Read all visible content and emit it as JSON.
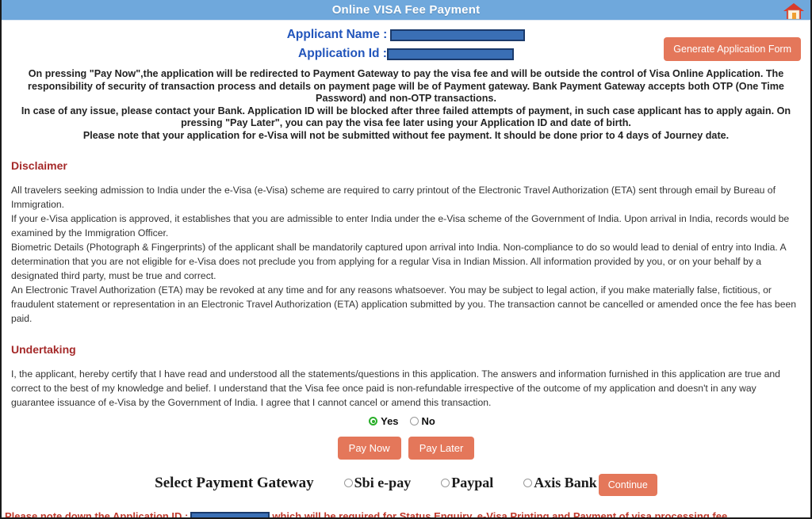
{
  "window": {
    "title": "Online VISA Fee Payment",
    "home_icon": "home-icon",
    "titlebar_color": "#6fa8dc"
  },
  "applicant": {
    "name_label": "Applicant Name :",
    "name_value": "",
    "appid_label": "Application Id :",
    "appid_value": "",
    "generate_button": "Generate Application Form",
    "label_color": "#2255bb",
    "redaction_color": "#3a6fb5"
  },
  "instructions": {
    "line1": "On pressing \"Pay Now\",the application will be redirected to Payment Gateway to pay the visa fee and will be outside the control of Visa Online Application. The responsibility of security of transaction process and details on payment page will be of Payment gateway. Bank Payment Gateway accepts both OTP (One Time Password) and non-OTP transactions.",
    "line2": "In case of any issue, please contact your Bank. Application ID will be blocked after three failed attempts of payment, in such case applicant has to apply again. On pressing \"Pay Later\", you can pay the visa fee later using your Application ID and date of birth.",
    "line3": "Please note that your application for e-Visa will not be submitted without fee payment. It should be done prior to 4 days of Journey date."
  },
  "disclaimer": {
    "heading": "Disclaimer",
    "heading_color": "#a52a2a",
    "para1": "All travelers seeking admission to India under the e-Visa (e-Visa) scheme are required to carry printout of the Electronic Travel Authorization (ETA) sent through email by Bureau of Immigration.",
    "para2": "If your e-Visa application is approved, it establishes that you are admissible to enter India under the e-Visa scheme of the Government of India. Upon arrival in India, records would be examined by the Immigration Officer.",
    "para3": "Biometric Details (Photograph & Fingerprints) of the applicant shall be mandatorily captured upon arrival into India. Non-compliance to do so would lead to denial of entry into India. A determination that you are not eligible for e-Visa does not preclude you from applying for a regular Visa in Indian Mission. All information provided by you, or on your behalf by a designated third party, must be true and correct.",
    "para4": "An Electronic Travel Authorization (ETA) may be revoked at any time and for any reasons whatsoever. You may be subject to legal action, if you make materially false, fictitious, or fraudulent statement or representation in an Electronic Travel Authorization (ETA) application submitted by you. The transaction cannot be cancelled or amended once the fee has been paid."
  },
  "undertaking": {
    "heading": "Undertaking",
    "heading_color": "#a52a2a",
    "para1": "I, the applicant, hereby certify that I have read and understood all the statements/questions in this application. The answers and information furnished in this application are true and correct to the best of my knowledge and belief. I understand that the Visa fee once paid is non-refundable irrespective of the outcome of my application and doesn't in any way guarantee issuance of e-Visa by the Government of India. I agree that I cannot cancel or amend this transaction.",
    "yes_label": "Yes",
    "no_label": "No",
    "selected": "Yes",
    "selected_color": "#2aaf2a"
  },
  "actions": {
    "pay_now": "Pay Now",
    "pay_later": "Pay Later",
    "continue": "Continue",
    "button_color": "#e4775a"
  },
  "gateway": {
    "title": "Select Payment Gateway",
    "options": [
      {
        "label": "Sbi e-pay",
        "selected": false
      },
      {
        "label": "Paypal",
        "selected": false
      },
      {
        "label": "Axis Bank",
        "selected": false
      }
    ]
  },
  "bottom_note": {
    "prefix": "Please note down the Application ID :",
    "id_value": "",
    "suffix": "which will be required for Status Enquiry, e-Visa Printing and Payment of visa processing fee.",
    "color": "#c0392b"
  }
}
